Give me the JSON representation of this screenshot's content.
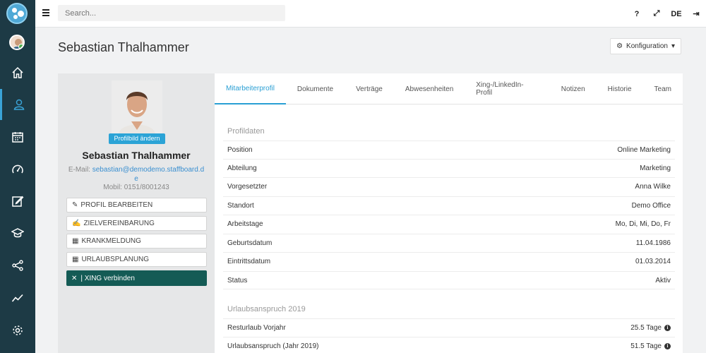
{
  "app": {
    "search_placeholder": "Search...",
    "help_icon": "?",
    "expand_icon": "⤢",
    "language": "DE",
    "logout_icon": "⇥"
  },
  "nav": {
    "icons": [
      "home-icon",
      "people-icon",
      "calendar-icon",
      "gauge-icon",
      "edit-icon",
      "graduation-icon",
      "share-icon",
      "chart-icon",
      "settings-icon"
    ],
    "active_index": 1,
    "rail_bg": "#1d3a45",
    "accent": "#3aa3d6"
  },
  "page": {
    "title": "Sebastian Thalhammer",
    "config_label": "Konfiguration"
  },
  "profile": {
    "change_photo": "Profilbild ändern",
    "name": "Sebastian Thalhammer",
    "email_label": "E-Mail:",
    "email": "sebastian@demodemo.staffboard.de",
    "mobile": "Mobil: 0151/8001243",
    "actions": [
      {
        "label": "Profil bearbeiten",
        "icon": "pencil-icon"
      },
      {
        "label": "Zielvereinbarung",
        "icon": "edit-icon"
      },
      {
        "label": "Krankmeldung",
        "icon": "calendar-icon"
      },
      {
        "label": "Urlaubsplanung",
        "icon": "calendar-icon"
      }
    ],
    "xing_label": "| XING verbinden",
    "xing_color": "#145b55"
  },
  "tabs": [
    "Mitarbeiterprofil",
    "Dokumente",
    "Verträge",
    "Abwesenheiten",
    "Xing-/LinkedIn-Profil",
    "Notizen",
    "Historie",
    "Team"
  ],
  "active_tab": 0,
  "sections": {
    "profile_title": "Profildaten",
    "profile_rows": [
      {
        "label": "Position",
        "value": "Online Marketing"
      },
      {
        "label": "Abteilung",
        "value": "Marketing"
      },
      {
        "label": "Vorgesetzter",
        "value": "Anna Wilke"
      },
      {
        "label": "Standort",
        "value": "Demo Office"
      },
      {
        "label": "Arbeitstage",
        "value": "Mo, Di, Mi, Do, Fr"
      },
      {
        "label": "Geburtsdatum",
        "value": "11.04.1986"
      },
      {
        "label": "Eintrittsdatum",
        "value": "01.03.2014"
      },
      {
        "label": "Status",
        "value": "Aktiv"
      }
    ],
    "vacation_title": "Urlaubsanspruch 2019",
    "vacation_rows": [
      {
        "label": "Resturlaub Vorjahr",
        "value": "25.5 Tage"
      },
      {
        "label": "Urlaubsanspruch (Jahr 2019)",
        "value": "51.5 Tage"
      }
    ]
  }
}
